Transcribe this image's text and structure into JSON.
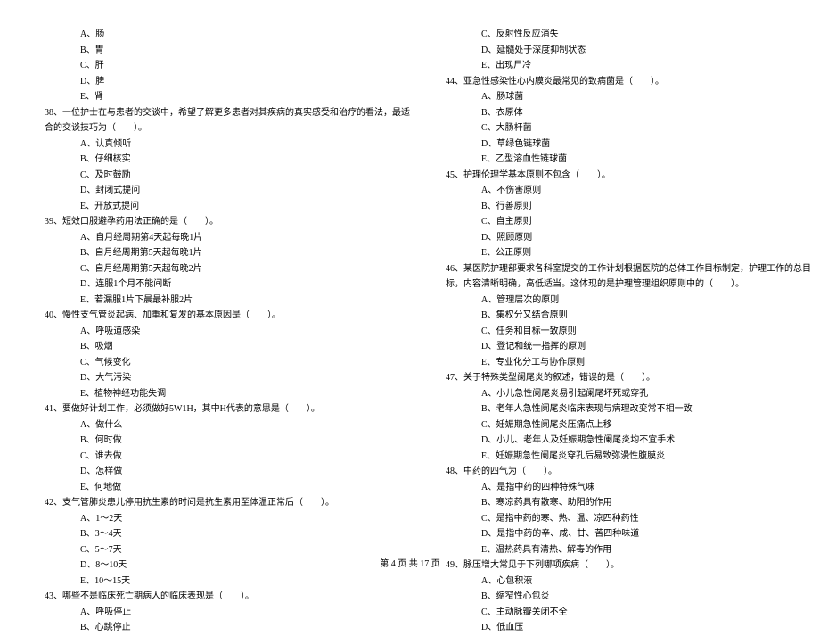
{
  "left_column": [
    {
      "type": "option",
      "text": "A、肠"
    },
    {
      "type": "option",
      "text": "B、胃"
    },
    {
      "type": "option",
      "text": "C、肝"
    },
    {
      "type": "option",
      "text": "D、脾"
    },
    {
      "type": "option",
      "text": "E、肾"
    },
    {
      "type": "question",
      "text": "38、一位护士在与患者的交谈中，希望了解更多患者对其疾病的真实感受和治疗的看法，最适"
    },
    {
      "type": "question-sub",
      "text": "合的交谈技巧为（　　）。"
    },
    {
      "type": "option",
      "text": "A、认真倾听"
    },
    {
      "type": "option",
      "text": "B、仔细核实"
    },
    {
      "type": "option",
      "text": "C、及时鼓励"
    },
    {
      "type": "option",
      "text": "D、封闭式提问"
    },
    {
      "type": "option",
      "text": "E、开放式提问"
    },
    {
      "type": "question",
      "text": "39、短效口服避孕药用法正确的是（　　）。"
    },
    {
      "type": "option",
      "text": "A、自月经周期第4天起每晚1片"
    },
    {
      "type": "option",
      "text": "B、自月经周期第5天起每晚1片"
    },
    {
      "type": "option",
      "text": "C、自月经周期第5天起每晚2片"
    },
    {
      "type": "option",
      "text": "D、连服1个月不能间断"
    },
    {
      "type": "option",
      "text": "E、若漏服1片下晨最补服2片"
    },
    {
      "type": "question",
      "text": "40、慢性支气管炎起病、加重和复发的基本原因是（　　）。"
    },
    {
      "type": "option",
      "text": "A、呼吸道感染"
    },
    {
      "type": "option",
      "text": "B、吸烟"
    },
    {
      "type": "option",
      "text": "C、气候变化"
    },
    {
      "type": "option",
      "text": "D、大气污染"
    },
    {
      "type": "option",
      "text": "E、植物神经功能失调"
    },
    {
      "type": "question",
      "text": "41、要做好计划工作，必须做好5W1H，其中H代表的意思是（　　）。"
    },
    {
      "type": "option",
      "text": "A、做什么"
    },
    {
      "type": "option",
      "text": "B、何时做"
    },
    {
      "type": "option",
      "text": "C、谁去做"
    },
    {
      "type": "option",
      "text": "D、怎样做"
    },
    {
      "type": "option",
      "text": "E、何地做"
    },
    {
      "type": "question",
      "text": "42、支气管肺炎患儿停用抗生素的时间是抗生素用至体温正常后（　　）。"
    },
    {
      "type": "option",
      "text": "A、1～2天"
    },
    {
      "type": "option",
      "text": "B、3～4天"
    },
    {
      "type": "option",
      "text": "C、5～7天"
    },
    {
      "type": "option",
      "text": "D、8～10天"
    },
    {
      "type": "option",
      "text": "E、10～15天"
    },
    {
      "type": "question",
      "text": "43、哪些不是临床死亡期病人的临床表现是（　　）。"
    },
    {
      "type": "option",
      "text": "A、呼吸停止"
    },
    {
      "type": "option",
      "text": "B、心跳停止"
    }
  ],
  "right_column": [
    {
      "type": "option",
      "text": "C、反射性反应消失"
    },
    {
      "type": "option",
      "text": "D、延髓处于深度抑制状态"
    },
    {
      "type": "option",
      "text": "E、出现尸冷"
    },
    {
      "type": "question",
      "text": "44、亚急性感染性心内膜炎最常见的致病菌是（　　）。"
    },
    {
      "type": "option",
      "text": "A、肠球菌"
    },
    {
      "type": "option",
      "text": "B、衣原体"
    },
    {
      "type": "option",
      "text": "C、大肠杆菌"
    },
    {
      "type": "option",
      "text": "D、草绿色链球菌"
    },
    {
      "type": "option",
      "text": "E、乙型溶血性链球菌"
    },
    {
      "type": "question",
      "text": "45、护理伦理学基本原则不包含（　　）。"
    },
    {
      "type": "option",
      "text": "A、不伤害原则"
    },
    {
      "type": "option",
      "text": "B、行善原则"
    },
    {
      "type": "option",
      "text": "C、自主原则"
    },
    {
      "type": "option",
      "text": "D、照顾原则"
    },
    {
      "type": "option",
      "text": "E、公正原则"
    },
    {
      "type": "question",
      "text": "46、某医院护理部要求各科室提交的工作计划根据医院的总体工作目标制定，护理工作的总目"
    },
    {
      "type": "question-sub",
      "text": "标，内容清晰明确，高低适当。这体现的是护理管理组织原则中的（　　）。"
    },
    {
      "type": "option",
      "text": "A、管理层次的原则"
    },
    {
      "type": "option",
      "text": "B、集权分又结合原则"
    },
    {
      "type": "option",
      "text": "C、任务和目标一致原则"
    },
    {
      "type": "option",
      "text": "D、登记和统一指挥的原则"
    },
    {
      "type": "option",
      "text": "E、专业化分工与协作原则"
    },
    {
      "type": "question",
      "text": "47、关于特殊类型阑尾炎的叙述，错误的是（　　）。"
    },
    {
      "type": "option",
      "text": "A、小儿急性阑尾炎易引起阑尾坏死或穿孔"
    },
    {
      "type": "option",
      "text": "B、老年人急性阑尾炎临床表现与病理改变常不相一致"
    },
    {
      "type": "option",
      "text": "C、妊娠期急性阑尾炎压痛点上移"
    },
    {
      "type": "option",
      "text": "D、小儿、老年人及妊娠期急性阑尾炎均不宜手术"
    },
    {
      "type": "option",
      "text": "E、妊娠期急性阑尾炎穿孔后易致弥漫性腹膜炎"
    },
    {
      "type": "question",
      "text": "48、中药的四气为（　　）。"
    },
    {
      "type": "option",
      "text": "A、是指中药的四种特殊气味"
    },
    {
      "type": "option",
      "text": "B、寒凉药具有散寒、助阳的作用"
    },
    {
      "type": "option",
      "text": "C、是指中药的寒、热、温、凉四种药性"
    },
    {
      "type": "option",
      "text": "D、是指中药的辛、咸、甘、苦四种味道"
    },
    {
      "type": "option",
      "text": "E、温热药具有清热、解毒的作用"
    },
    {
      "type": "question",
      "text": "49、脉压增大常见于下列哪项疾病（　　）。"
    },
    {
      "type": "option",
      "text": "A、心包积液"
    },
    {
      "type": "option",
      "text": "B、缩窄性心包炎"
    },
    {
      "type": "option",
      "text": "C、主动脉瓣关闭不全"
    },
    {
      "type": "option",
      "text": "D、低血压"
    }
  ],
  "footer": "第 4 页 共 17 页"
}
